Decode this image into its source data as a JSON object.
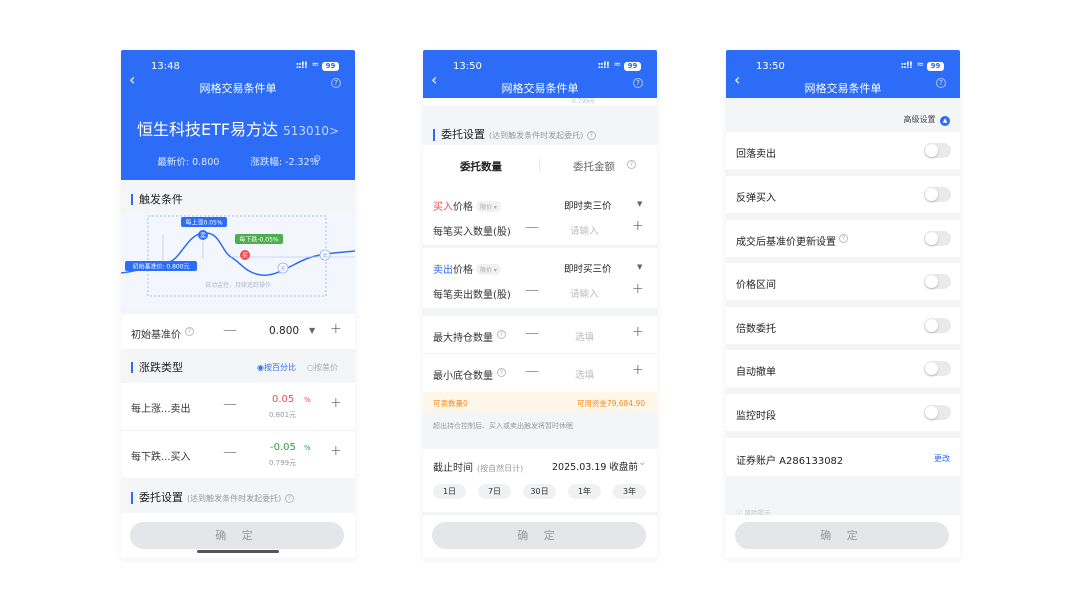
{
  "brand_color": "#2c6cf6",
  "phones": [
    {
      "status": {
        "time": "13:48",
        "battery": "99"
      },
      "nav": {
        "title": "网格交易条件单"
      },
      "fund": {
        "name": "恒生科技ETF易方达",
        "code": "513010",
        "chevron": ">"
      },
      "quote": {
        "price": "最新价: 0.800",
        "change": "涨跌幅: -2.32%"
      },
      "trigger": {
        "title": "触发条件",
        "chart": {
          "rise_tag": "每上涨0.05%",
          "fall_tag": "每下跌-0.05%",
          "base_tag": "初始基准价: 0.800元",
          "sell_badge": "卖",
          "buy_badge": "买",
          "idle1": "买",
          "idle2": "卖",
          "footnote": "自动监控，持续追踪操作"
        }
      },
      "base_price": {
        "label": "初始基准价",
        "value": "0.800"
      },
      "change_type": {
        "title": "涨跌类型",
        "opt1": "◉按百分比",
        "opt2": "○按差价"
      },
      "rise": {
        "label": "每上涨...卖出",
        "value": "0.05",
        "unit": "%",
        "sub": "0.801元"
      },
      "fall": {
        "label": "每下跌...买入",
        "value": "-0.05",
        "unit": "%",
        "sub": "0.799元"
      },
      "order": {
        "title": "委托设置",
        "sub": "(达到触发条件时发起委托)"
      },
      "confirm": "确 定"
    },
    {
      "status": {
        "time": "13:50",
        "battery": "99"
      },
      "nav": {
        "title": "网格交易条件单"
      },
      "top_cut": "0.799元",
      "order": {
        "title": "委托设置",
        "sub": "(达到触发条件时发起委托)"
      },
      "tabs": {
        "qty": "委托数量",
        "amount": "委托金额"
      },
      "buy": {
        "label_a": "买入",
        "label_b": "价格",
        "chip": "限价 ▾",
        "price": "即时卖三价",
        "qty_label": "每笔买入数量(股)",
        "qty_ph": "请输入"
      },
      "sell": {
        "label_a": "卖出",
        "label_b": "价格",
        "chip": "限价 ▾",
        "price": "即时买三价",
        "qty_label": "每笔卖出数量(股)",
        "qty_ph": "请输入"
      },
      "max_hold": {
        "label": "最大持仓数量",
        "ph": "选填"
      },
      "min_hold": {
        "label": "最小底仓数量",
        "ph": "选填"
      },
      "avail": {
        "sellable": "可卖数量0",
        "cash": "可用资金79,684.90"
      },
      "hint": "超出持仓控制后、买入或卖出触发将暂时休眠",
      "expiry": {
        "label": "截止时间",
        "sub": "(按自然日计)",
        "value": "2025.03.19 收盘前"
      },
      "durations": [
        "1日",
        "7日",
        "30日",
        "1年",
        "3年"
      ],
      "confirm": "确 定"
    },
    {
      "status": {
        "time": "13:50",
        "battery": "99"
      },
      "nav": {
        "title": "网格交易条件单"
      },
      "advanced": "高级设置",
      "toggles": [
        "回落卖出",
        "反弹买入",
        "成交后基准价更新设置",
        "价格区间",
        "倍数委托",
        "自动撤单",
        "监控时段"
      ],
      "account": {
        "label": "证券账户 A286133082",
        "action": "更改"
      },
      "bottom_hint": "风险提示",
      "confirm": "确 定"
    }
  ]
}
